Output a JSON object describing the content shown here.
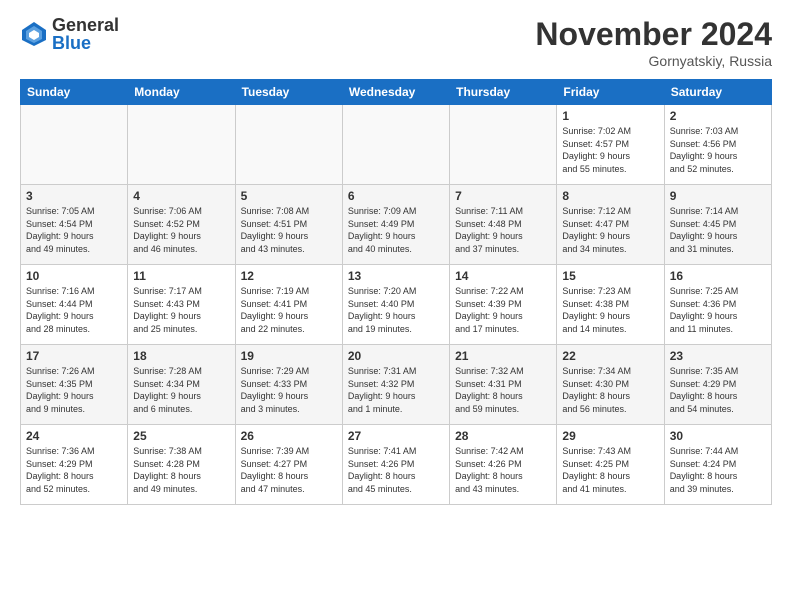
{
  "header": {
    "logo_general": "General",
    "logo_blue": "Blue",
    "month_title": "November 2024",
    "location": "Gornyatskiy, Russia"
  },
  "days_of_week": [
    "Sunday",
    "Monday",
    "Tuesday",
    "Wednesday",
    "Thursday",
    "Friday",
    "Saturday"
  ],
  "weeks": [
    [
      {
        "day": "",
        "info": ""
      },
      {
        "day": "",
        "info": ""
      },
      {
        "day": "",
        "info": ""
      },
      {
        "day": "",
        "info": ""
      },
      {
        "day": "",
        "info": ""
      },
      {
        "day": "1",
        "info": "Sunrise: 7:02 AM\nSunset: 4:57 PM\nDaylight: 9 hours\nand 55 minutes."
      },
      {
        "day": "2",
        "info": "Sunrise: 7:03 AM\nSunset: 4:56 PM\nDaylight: 9 hours\nand 52 minutes."
      }
    ],
    [
      {
        "day": "3",
        "info": "Sunrise: 7:05 AM\nSunset: 4:54 PM\nDaylight: 9 hours\nand 49 minutes."
      },
      {
        "day": "4",
        "info": "Sunrise: 7:06 AM\nSunset: 4:52 PM\nDaylight: 9 hours\nand 46 minutes."
      },
      {
        "day": "5",
        "info": "Sunrise: 7:08 AM\nSunset: 4:51 PM\nDaylight: 9 hours\nand 43 minutes."
      },
      {
        "day": "6",
        "info": "Sunrise: 7:09 AM\nSunset: 4:49 PM\nDaylight: 9 hours\nand 40 minutes."
      },
      {
        "day": "7",
        "info": "Sunrise: 7:11 AM\nSunset: 4:48 PM\nDaylight: 9 hours\nand 37 minutes."
      },
      {
        "day": "8",
        "info": "Sunrise: 7:12 AM\nSunset: 4:47 PM\nDaylight: 9 hours\nand 34 minutes."
      },
      {
        "day": "9",
        "info": "Sunrise: 7:14 AM\nSunset: 4:45 PM\nDaylight: 9 hours\nand 31 minutes."
      }
    ],
    [
      {
        "day": "10",
        "info": "Sunrise: 7:16 AM\nSunset: 4:44 PM\nDaylight: 9 hours\nand 28 minutes."
      },
      {
        "day": "11",
        "info": "Sunrise: 7:17 AM\nSunset: 4:43 PM\nDaylight: 9 hours\nand 25 minutes."
      },
      {
        "day": "12",
        "info": "Sunrise: 7:19 AM\nSunset: 4:41 PM\nDaylight: 9 hours\nand 22 minutes."
      },
      {
        "day": "13",
        "info": "Sunrise: 7:20 AM\nSunset: 4:40 PM\nDaylight: 9 hours\nand 19 minutes."
      },
      {
        "day": "14",
        "info": "Sunrise: 7:22 AM\nSunset: 4:39 PM\nDaylight: 9 hours\nand 17 minutes."
      },
      {
        "day": "15",
        "info": "Sunrise: 7:23 AM\nSunset: 4:38 PM\nDaylight: 9 hours\nand 14 minutes."
      },
      {
        "day": "16",
        "info": "Sunrise: 7:25 AM\nSunset: 4:36 PM\nDaylight: 9 hours\nand 11 minutes."
      }
    ],
    [
      {
        "day": "17",
        "info": "Sunrise: 7:26 AM\nSunset: 4:35 PM\nDaylight: 9 hours\nand 9 minutes."
      },
      {
        "day": "18",
        "info": "Sunrise: 7:28 AM\nSunset: 4:34 PM\nDaylight: 9 hours\nand 6 minutes."
      },
      {
        "day": "19",
        "info": "Sunrise: 7:29 AM\nSunset: 4:33 PM\nDaylight: 9 hours\nand 3 minutes."
      },
      {
        "day": "20",
        "info": "Sunrise: 7:31 AM\nSunset: 4:32 PM\nDaylight: 9 hours\nand 1 minute."
      },
      {
        "day": "21",
        "info": "Sunrise: 7:32 AM\nSunset: 4:31 PM\nDaylight: 8 hours\nand 59 minutes."
      },
      {
        "day": "22",
        "info": "Sunrise: 7:34 AM\nSunset: 4:30 PM\nDaylight: 8 hours\nand 56 minutes."
      },
      {
        "day": "23",
        "info": "Sunrise: 7:35 AM\nSunset: 4:29 PM\nDaylight: 8 hours\nand 54 minutes."
      }
    ],
    [
      {
        "day": "24",
        "info": "Sunrise: 7:36 AM\nSunset: 4:29 PM\nDaylight: 8 hours\nand 52 minutes."
      },
      {
        "day": "25",
        "info": "Sunrise: 7:38 AM\nSunset: 4:28 PM\nDaylight: 8 hours\nand 49 minutes."
      },
      {
        "day": "26",
        "info": "Sunrise: 7:39 AM\nSunset: 4:27 PM\nDaylight: 8 hours\nand 47 minutes."
      },
      {
        "day": "27",
        "info": "Sunrise: 7:41 AM\nSunset: 4:26 PM\nDaylight: 8 hours\nand 45 minutes."
      },
      {
        "day": "28",
        "info": "Sunrise: 7:42 AM\nSunset: 4:26 PM\nDaylight: 8 hours\nand 43 minutes."
      },
      {
        "day": "29",
        "info": "Sunrise: 7:43 AM\nSunset: 4:25 PM\nDaylight: 8 hours\nand 41 minutes."
      },
      {
        "day": "30",
        "info": "Sunrise: 7:44 AM\nSunset: 4:24 PM\nDaylight: 8 hours\nand 39 minutes."
      }
    ]
  ]
}
